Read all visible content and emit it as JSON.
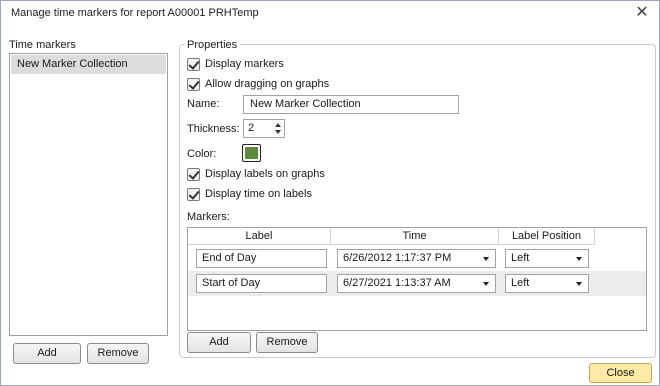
{
  "window": {
    "title": "Manage time markers for report A00001 PRHTemp",
    "close_glyph": "✕"
  },
  "left_panel": {
    "label": "Time markers",
    "items": [
      "New Marker Collection"
    ],
    "add_label": "Add",
    "remove_label": "Remove"
  },
  "properties": {
    "group_title": "Properties",
    "display_markers": {
      "label": "Display markers",
      "checked": true
    },
    "allow_dragging": {
      "label": "Allow dragging on graphs",
      "checked": true
    },
    "name_label": "Name:",
    "name_value": "New Marker Collection",
    "thickness_label": "Thickness:",
    "thickness_value": "2",
    "color_label": "Color:",
    "color_value": "#5a8a3a",
    "display_labels": {
      "label": "Display labels on graphs",
      "checked": true
    },
    "display_time": {
      "label": "Display time on labels",
      "checked": true
    },
    "markers_label": "Markers:"
  },
  "markers": {
    "columns": [
      "Label",
      "Time",
      "Label Position"
    ],
    "rows": [
      {
        "label": "End of Day",
        "time": "6/26/2012 1:17:37 PM",
        "position": "Left"
      },
      {
        "label": "Start of Day",
        "time": "6/27/2021 1:13:37 AM",
        "position": "Left"
      }
    ],
    "add_label": "Add",
    "remove_label": "Remove"
  },
  "footer": {
    "close_label": "Close",
    "close_color": "#fde9a8"
  }
}
